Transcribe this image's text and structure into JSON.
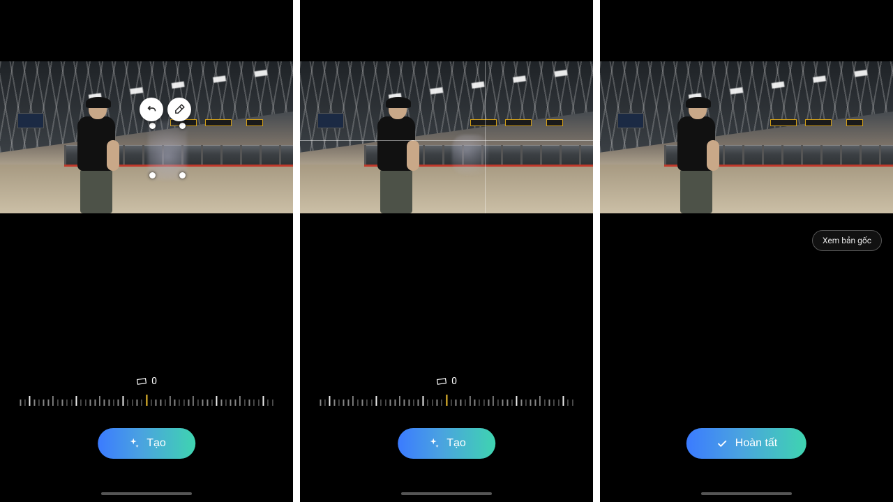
{
  "panels": [
    {
      "angle_value": "0",
      "primary_label": "Tạo",
      "tools": {
        "undo": "undo-icon",
        "erase": "eraser-icon"
      }
    },
    {
      "angle_value": "0",
      "primary_label": "Tạo"
    },
    {
      "chip_label": "Xem bản gốc",
      "primary_label": "Hoàn tất"
    }
  ]
}
